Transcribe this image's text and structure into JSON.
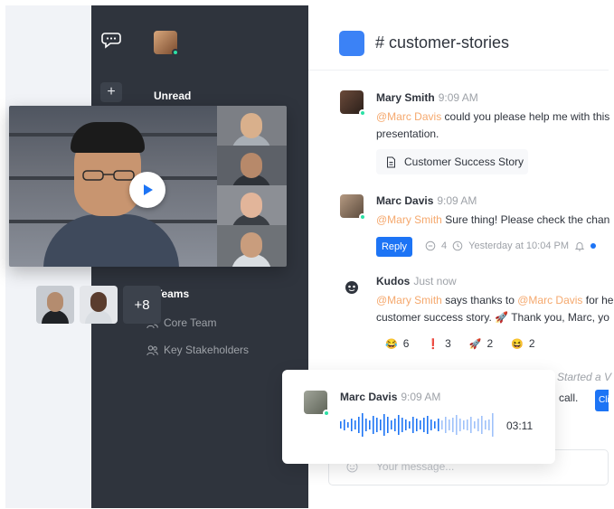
{
  "channel": {
    "title": "# customer-stories"
  },
  "sidebar": {
    "unread_label": "Unread",
    "teams_label": "Teams",
    "teams": [
      {
        "label": "Core Team"
      },
      {
        "label": "Key Stakeholders"
      }
    ]
  },
  "messages": [
    {
      "author": "Mary Smith",
      "time": "9:09 AM",
      "mention": "@Marc Davis",
      "text_after_mention": " could you please help me with this",
      "text_line2": "presentation.",
      "attachment": "Customer Success Story"
    },
    {
      "author": "Marc Davis",
      "time": "9:09 AM",
      "mention": "@Mary Smith",
      "text_after_mention": " Sure thing! Please check the chan",
      "reply_label": "Reply",
      "reply_count": "4",
      "thread_time": "Yesterday at 10:04 PM"
    },
    {
      "author": "Kudos",
      "time": "Just now",
      "mention1": "@Mary Smith",
      "text_mid": " says thanks to ",
      "mention2": "@Marc Davis",
      "text_end": " for he",
      "text_line2": "customer success story. 🚀 Thank you, Marc, yo"
    }
  ],
  "reactions": [
    {
      "emoji": "😂",
      "count": "6"
    },
    {
      "emoji": "❗",
      "count": "3"
    },
    {
      "emoji": "🚀",
      "count": "2"
    },
    {
      "emoji": "😆",
      "count": "2"
    }
  ],
  "call": {
    "started_text": "Started a V",
    "call_text": "call.",
    "button_label": "Cli"
  },
  "audio": {
    "author": "Marc Davis",
    "time": "9:09 AM",
    "duration": "03:11"
  },
  "video": {
    "more_count": "+8"
  },
  "composer": {
    "placeholder": "Your message..."
  },
  "colors": {
    "sidebar": "#2f343d",
    "accent": "#1d74f5",
    "channel_icon": "#3b82f6",
    "mention": "#f5a86d",
    "online": "#2de0a5"
  }
}
